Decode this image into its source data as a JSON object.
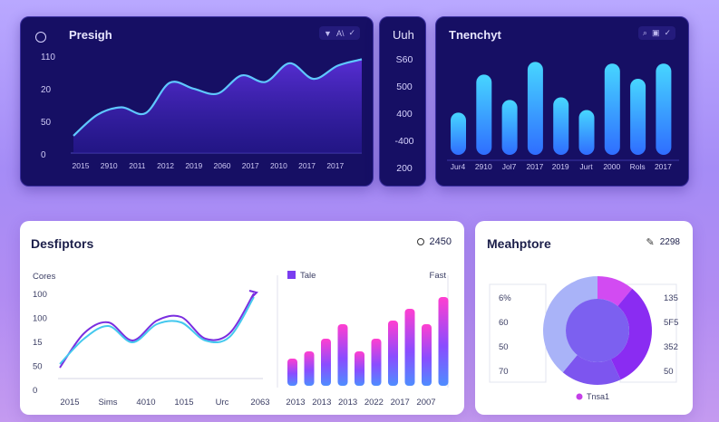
{
  "colors": {
    "dark_panel": "#160f64",
    "cyan": "#4fd2ff",
    "blue": "#2f7bff",
    "purple": "#7a3df0",
    "pink": "#ff3fd0"
  },
  "panel_tl": {
    "title": "Presigh",
    "tools": [
      "▼",
      "A\\",
      "✓"
    ]
  },
  "panel_tm": {
    "title": "Uuh"
  },
  "panel_tr": {
    "title": "Tnenchyt",
    "tools": [
      "⌕",
      "▣",
      "✓"
    ]
  },
  "panel_bl": {
    "title": "Desfiptors",
    "badge": "2450"
  },
  "panel_br": {
    "title": "Meahptore",
    "badge": "2298"
  },
  "chart_data": [
    {
      "type": "line",
      "title": "Presigh",
      "y_ticks": [
        "110",
        "20",
        "50",
        "0"
      ],
      "x_ticks": [
        "2015",
        "2910",
        "2011",
        "2012",
        "2019",
        "2060",
        "2017",
        "2010",
        "2017",
        "2017"
      ],
      "series": [
        {
          "values": [
            2,
            45,
            60,
            48,
            110,
            98,
            88,
            125,
            112,
            150,
            118,
            145,
            158
          ]
        }
      ],
      "ylim": [
        0,
        170
      ]
    },
    {
      "type": "table",
      "title": "Uuh",
      "values": [
        "S60",
        "500",
        "400",
        "-400",
        "200"
      ]
    },
    {
      "type": "bar",
      "title": "Tnenchyt",
      "x_ticks": [
        "Jur4",
        "2910",
        "Jol7",
        "2017",
        "2019",
        "Jurt",
        "2000",
        "Rols",
        "2017"
      ],
      "values": [
        50,
        95,
        65,
        110,
        68,
        53,
        108,
        90,
        108
      ],
      "ylim": [
        0,
        120
      ]
    },
    {
      "type": "line",
      "title": "Desfiptors",
      "ylabel": "Cores",
      "y_ticks": [
        "100",
        "100",
        "15",
        "50",
        "0"
      ],
      "x_ticks": [
        "2015",
        "Sims",
        "4010",
        "1015",
        "Urc",
        "2063"
      ],
      "series": [
        {
          "values": [
            0,
            38,
            50,
            30,
            52,
            56,
            32,
            38,
            82
          ]
        },
        {
          "values": [
            4,
            32,
            46,
            28,
            48,
            50,
            30,
            34,
            78
          ]
        }
      ],
      "ylim": [
        0,
        100
      ]
    },
    {
      "type": "bar",
      "legend": "Tale",
      "right_label": "Fast",
      "x_ticks": [
        "2013",
        "2013",
        "2013",
        "2022",
        "2017",
        "2007"
      ],
      "values": [
        30,
        38,
        52,
        68,
        38,
        52,
        72,
        85,
        68,
        98
      ],
      "ylim": [
        0,
        110
      ]
    },
    {
      "type": "pie",
      "legend": "Tnsa1",
      "left_ticks": [
        "6%",
        "60",
        "50",
        "70"
      ],
      "right_ticks": [
        "135",
        "5F5",
        "352",
        "50"
      ],
      "slices": [
        {
          "value": 11,
          "color": "#d24bf2"
        },
        {
          "value": 32,
          "color": "#8a2cf2"
        },
        {
          "value": 18,
          "color": "#7d55ef"
        },
        {
          "value": 39,
          "color": "#a9b3f8"
        }
      ]
    }
  ]
}
